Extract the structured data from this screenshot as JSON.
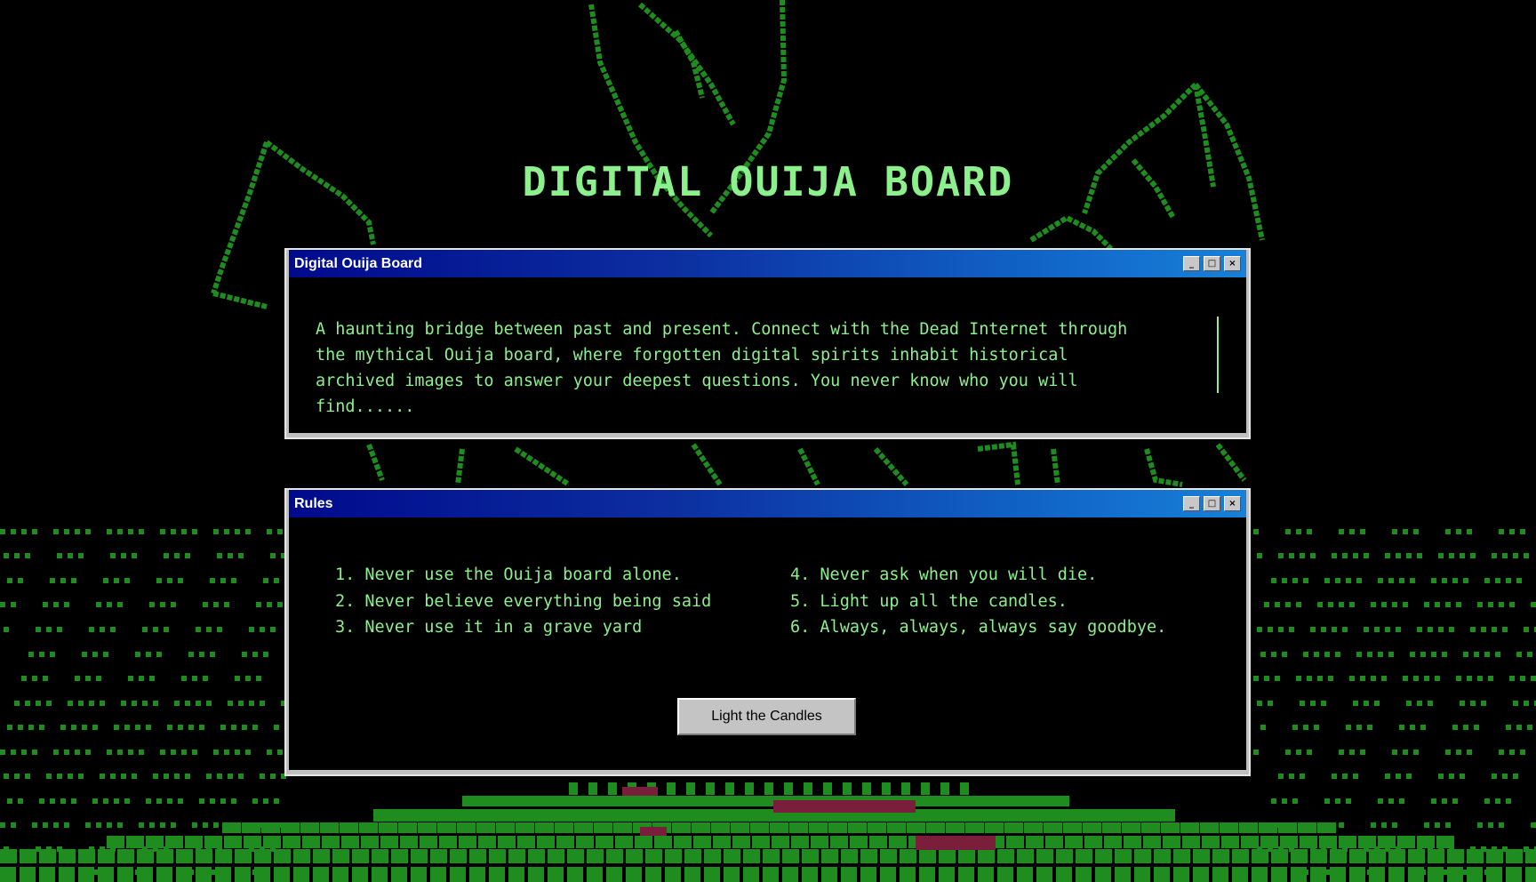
{
  "page": {
    "title": "DIGITAL OUIJA BOARD"
  },
  "intro_window": {
    "title": "Digital Ouija Board",
    "body": "A haunting bridge between past and present. Connect with the Dead Internet through the mythical Ouija board, where forgotten digital spirits inhabit historical archived images to answer your deepest questions. You never know who you will find......",
    "controls": {
      "minimize": "_",
      "maximize": "□",
      "close": "×"
    }
  },
  "rules_window": {
    "title": "Rules",
    "controls": {
      "minimize": "_",
      "maximize": "□",
      "close": "×"
    },
    "rules_left": [
      "1. Never use the Ouija board alone.",
      "2. Never believe everything being said",
      "3. Never use it in a grave yard"
    ],
    "rules_right": [
      "4. Never ask when you will die.",
      "5. Light up all the candles.",
      "6. Always, always, always say goodbye."
    ],
    "button_label": "Light the Candles"
  },
  "colors": {
    "terminal_green": "#8cf08c",
    "art_green": "#1e8c1e",
    "art_red": "#7a1e3c",
    "titlebar_start": "#000a8c",
    "titlebar_end": "#1780d8"
  }
}
